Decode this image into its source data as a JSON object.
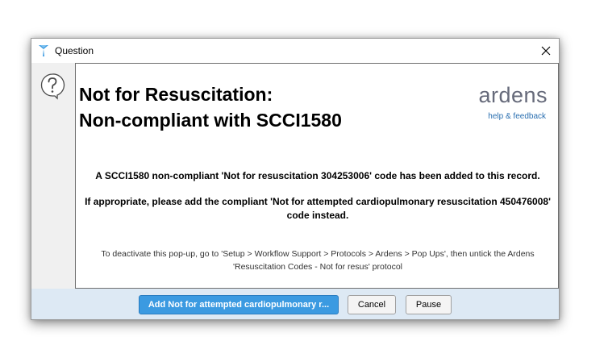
{
  "window": {
    "title": "Question",
    "app_icon": "ardens-triangle-icon",
    "close_icon": "close-icon"
  },
  "sidebar": {
    "icon": "question-mark-icon"
  },
  "content": {
    "heading_line1": "Not for Resuscitation:",
    "heading_line2": "Non-compliant with SCCI1580",
    "brand": "ardens",
    "help_link": "help & feedback",
    "message1": "A SCCI1580 non-compliant 'Not for resuscitation 304253006' code has been added to this record.",
    "message2": "If appropriate, please add the compliant 'Not for attempted cardiopulmonary resuscitation 450476008' code instead.",
    "note": "To deactivate this pop-up, go to 'Setup > Workflow Support > Protocols > Ardens > Pop Ups', then untick the Ardens 'Resuscitation Codes - Not for resus' protocol"
  },
  "footer": {
    "primary_button": "Add Not for attempted cardiopulmonary r...",
    "cancel_button": "Cancel",
    "pause_button": "Pause"
  },
  "colors": {
    "brand_text": "#666a7a",
    "link": "#2a6fb0",
    "primary_button": "#3b9ae1",
    "footer_bg": "#dde9f4"
  }
}
